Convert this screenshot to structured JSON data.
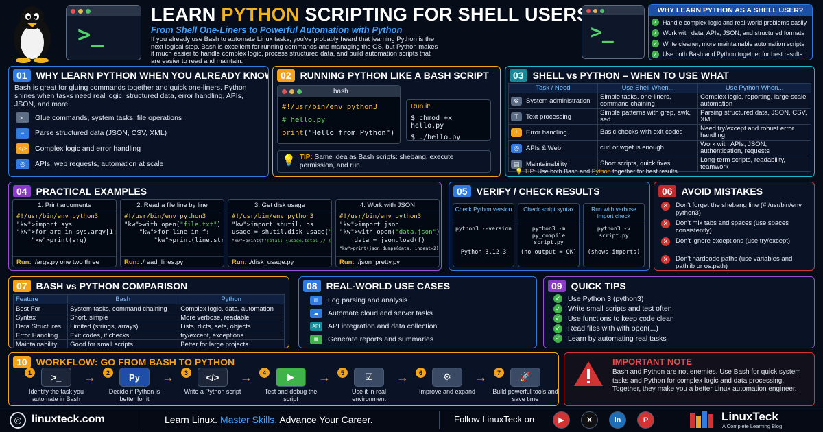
{
  "header": {
    "title_a": "LEARN ",
    "title_b": "PYTHON",
    "title_c": " SCRIPTING FOR SHELL USERS",
    "subtitle": "From Shell One-Liners to Powerful Automation with Python",
    "intro": "If you already use Bash to automate Linux tasks, you've probably heard that learning Python is the next logical step. Bash is excellent for running commands and managing the OS, but Python makes it much easier to handle complex logic, process structured data, and build automation scripts that are easier to read and maintain.",
    "prompt": ">_"
  },
  "why_box": {
    "title": "WHY LEARN PYTHON AS A SHELL USER?",
    "items": [
      "Handle complex logic and real-world problems easily",
      "Work with data, APIs, JSON, and structured formats",
      "Write cleaner, more maintainable automation scripts",
      "Use both Bash and Python together for best results"
    ]
  },
  "s01": {
    "num": "01",
    "title": "WHY LEARN PYTHON WHEN YOU ALREADY KNOW BASH?",
    "body": "Bash is great for gluing commands together and quick one-liners. Python shines when tasks need real logic, structured data, error handling, APIs, JSON, and more.",
    "items": [
      {
        "icon": ">_",
        "label": "Glue commands, system tasks, file operations"
      },
      {
        "icon": "≡",
        "label": "Parse structured data (JSON, CSV, XML)"
      },
      {
        "icon": "</>",
        "label": "Complex logic and error handling"
      },
      {
        "icon": "◎",
        "label": "APIs, web requests, automation at scale"
      }
    ]
  },
  "s02": {
    "num": "02",
    "title": "RUNNING PYTHON LIKE A BASH SCRIPT",
    "tab": "bash",
    "code": [
      "#!/usr/bin/env python3",
      "# hello.py",
      "print(\"Hello from Python\")"
    ],
    "run_label": "Run it:",
    "run": [
      "$  chmod +x hello.py",
      "$  ./hello.py"
    ],
    "tip_label": "TIP:",
    "tip": "Same idea as Bash scripts: shebang, execute permission, and run."
  },
  "s03": {
    "num": "03",
    "title": "SHELL vs PYTHON – WHEN TO USE WHAT",
    "headers": [
      "Task / Need",
      "Use Shell When...",
      "Use Python When..."
    ],
    "rows": [
      {
        "icon": "⚙",
        "task": "System administration",
        "shell": "Simple tasks, one-liners, command chaining",
        "python": "Complex logic, reporting, large-scale automation"
      },
      {
        "icon": "T",
        "task": "Text processing",
        "shell": "Simple patterns with grep, awk, sed",
        "python": "Parsing structured data, JSON, CSV, XML"
      },
      {
        "icon": "!",
        "task": "Error handling",
        "shell": "Basic checks with exit codes",
        "python": "Need try/except and robust error handling"
      },
      {
        "icon": "◎",
        "task": "APIs & Web",
        "shell": "curl or wget is enough",
        "python": "Work with APIs, JSON, authentication, requests"
      },
      {
        "icon": "▤",
        "task": "Maintainability",
        "shell": "Short scripts, quick fixes",
        "python": "Long-term scripts, readability, teamwork"
      }
    ],
    "tip_label": "TIP:",
    "tip_a": "Use both Bash and ",
    "tip_b": "Python",
    "tip_c": " together for best results."
  },
  "s04": {
    "num": "04",
    "title": "PRACTICAL EXAMPLES",
    "run_label": "Run:",
    "examples": [
      {
        "head": "1. Print arguments",
        "lines": [
          "#!/usr/bin/env python3",
          "import sys",
          "for arg in sys.argv[1:]:",
          "    print(arg)"
        ],
        "run": "./args.py one two three"
      },
      {
        "head": "2. Read a file line by line",
        "lines": [
          "#!/usr/bin/env python3",
          "with open(\"file.txt\") as f:",
          "    for line in f:",
          "        print(line.strip())"
        ],
        "run": "./read_lines.py"
      },
      {
        "head": "3. Get disk usage",
        "lines": [
          "#!/usr/bin/env python3",
          "import shutil, os",
          "usage = shutil.disk_usage(\"/\")",
          "print(f\"Total: {usage.total // (1024**3)} GB\")"
        ],
        "run": "./disk_usage.py"
      },
      {
        "head": "4. Work with JSON",
        "lines": [
          "#!/usr/bin/env python3",
          "import json",
          "with open(\"data.json\") as f:",
          "    data = json.load(f)",
          "print(json.dumps(data, indent=2))"
        ],
        "run": "./json_pretty.py"
      }
    ]
  },
  "s05": {
    "num": "05",
    "title": "VERIFY / CHECK RESULTS",
    "cols": [
      {
        "head": "Check Python version",
        "cmd": "python3 --version",
        "out": "Python 3.12.3"
      },
      {
        "head": "Check script syntax",
        "cmd": "python3 -m py_compile script.py",
        "out": "(no output = OK)"
      },
      {
        "head": "Run with verbose import check",
        "cmd": "python3 -v script.py",
        "out": "(shows imports)"
      }
    ]
  },
  "s06": {
    "num": "06",
    "title": "AVOID MISTAKES",
    "items": [
      "Don't forget the shebang line (#!/usr/bin/env python3)",
      "Don't mix tabs and spaces (use spaces consistently)",
      "Don't ignore exceptions (use try/except)",
      "Don't hardcode paths (use variables and pathlib or os.path)"
    ]
  },
  "s07": {
    "num": "07",
    "title": "BASH vs PYTHON COMPARISON",
    "headers": [
      "Feature",
      "Bash",
      "Python"
    ],
    "rows": [
      [
        "Best For",
        "System tasks, command chaining",
        "Complex logic, data, automation"
      ],
      [
        "Syntax",
        "Short, simple",
        "More verbose, readable"
      ],
      [
        "Data Structures",
        "Limited (strings, arrays)",
        "Lists, dicts, sets, objects"
      ],
      [
        "Error Handling",
        "Exit codes, if checks",
        "try/except, exceptions"
      ],
      [
        "Maintainability",
        "Good for small scripts",
        "Better for large projects"
      ]
    ]
  },
  "s08": {
    "num": "08",
    "title": "REAL-WORLD USE CASES",
    "items": [
      {
        "icon": "▤",
        "label": "Log parsing and analysis"
      },
      {
        "icon": "☁",
        "label": "Automate cloud and server tasks"
      },
      {
        "icon": "API",
        "label": "API integration and data collection"
      },
      {
        "icon": "▦",
        "label": "Generate reports and summaries"
      }
    ]
  },
  "s09": {
    "num": "09",
    "title": "QUICK TIPS",
    "items": [
      "Use Python 3 (python3)",
      "Write small scripts and test often",
      "Use functions to keep code clean",
      "Read files with with open(...)",
      "Learn by automating real tasks"
    ]
  },
  "s10": {
    "num": "10",
    "title": "WORKFLOW: GO FROM BASH TO PYTHON",
    "steps": [
      {
        "n": "1",
        "icon": ">_",
        "label": "Identify the task you automate in Bash"
      },
      {
        "n": "2",
        "icon": "Py",
        "label": "Decide if Python is better for it"
      },
      {
        "n": "3",
        "icon": "</>",
        "label": "Write a Python script"
      },
      {
        "n": "4",
        "icon": "▶",
        "label": "Test and debug the script"
      },
      {
        "n": "5",
        "icon": "☑",
        "label": "Use it in real environment"
      },
      {
        "n": "6",
        "icon": "⚙",
        "label": "Improve and expand"
      },
      {
        "n": "7",
        "icon": "🚀",
        "label": "Build powerful tools and save time"
      }
    ]
  },
  "note": {
    "title": "IMPORTANT NOTE",
    "body": "Bash and Python are not enemies. Use Bash for quick system tasks and Python for complex logic and data processing. Together, they make you a better Linux automation engineer."
  },
  "footer": {
    "site": "linuxteck.com",
    "slogan_a": "Learn Linux. ",
    "slogan_b": "Master Skills. ",
    "slogan_c": "Advance Your Career.",
    "follow": "Follow LinuxTeck on",
    "social": [
      {
        "icon": "▶"
      },
      {
        "icon": "X"
      },
      {
        "icon": "in"
      },
      {
        "icon": "P"
      }
    ],
    "brand": "LinuxTeck",
    "brand_sub": "A Complete Learning Blog"
  },
  "colors": {
    "orange": "#f2a21c",
    "blue": "#2f7be0",
    "teal": "#20b8c8",
    "purple": "#9b4fd6",
    "green": "#3fb24a",
    "red": "#d23434"
  }
}
